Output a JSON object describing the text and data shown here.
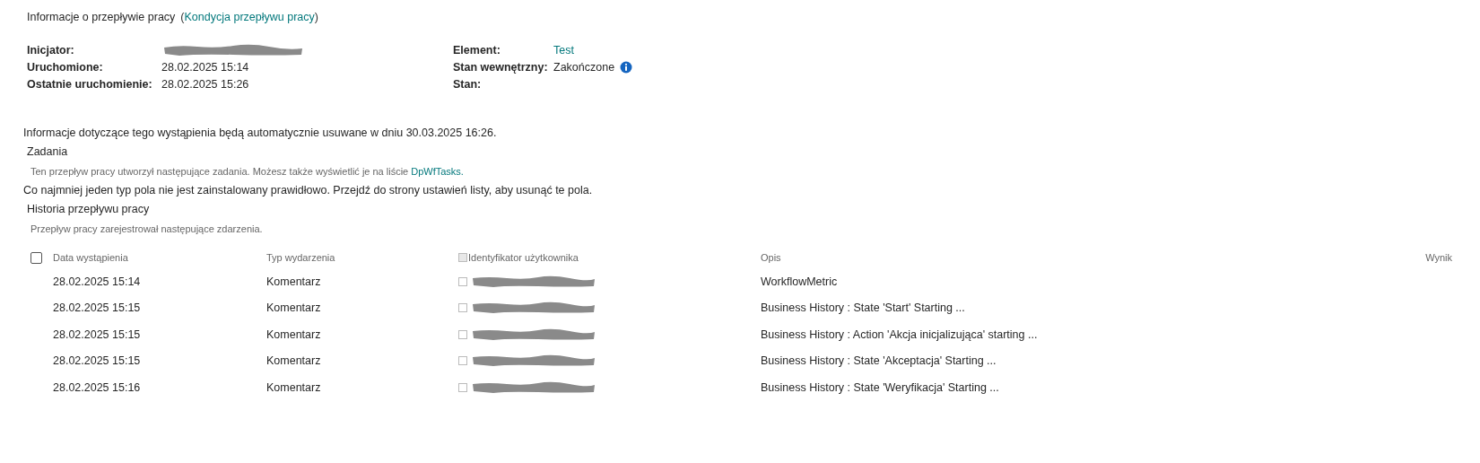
{
  "header": {
    "title": "Informacje o przepływie pracy",
    "link_open": "(",
    "link": "Kondycja przepływu pracy",
    "link_close": ")"
  },
  "info_left": [
    {
      "label": "Inicjator:",
      "redacted": true
    },
    {
      "label": "Uruchomione:",
      "value": "28.02.2025 15:14",
      "redacted": false
    },
    {
      "label": "Ostatnie uruchomienie:",
      "value": "28.02.2025 15:26",
      "redacted": false
    }
  ],
  "info_right": [
    {
      "label": "Element:",
      "value": "Test",
      "kind": "link"
    },
    {
      "label": "Stan wewnętrzny:",
      "value": "Zakończone",
      "kind": "info"
    },
    {
      "label": "Stan:",
      "kind": "empty"
    }
  ],
  "retention_notice": "Informacje dotyczące tego wystąpienia będą automatycznie usuwane w dniu 30.03.2025 16:26.",
  "tasks": {
    "title": "Zadania",
    "description": "Ten przepływ pracy utworzył następujące zadania. Możesz także wyświetlić je na liście",
    "link": "DpWfTasks."
  },
  "warning": "Co najmniej jeden typ pola nie jest zainstalowany prawidłowo. Przejdź do strony ustawień listy, aby usunąć te pola.",
  "history": {
    "title": "Historia przepływu pracy",
    "description": "Przepływ pracy zarejestrował następujące zdarzenia.",
    "select_all": {
      "checked": false
    },
    "columns": [
      "Data wystąpienia",
      "Typ wydarzenia",
      "Identyfikator użytkownika",
      "Opis",
      "Wynik"
    ],
    "rows": [
      {
        "date": "28.02.2025 15:14",
        "type": "Komentarz",
        "user_redacted": true,
        "description": "WorkflowMetric"
      },
      {
        "date": "28.02.2025 15:15",
        "type": "Komentarz",
        "user_redacted": true,
        "description": "Business History : State  'Start' Starting ..."
      },
      {
        "date": "28.02.2025 15:15",
        "type": "Komentarz",
        "user_redacted": true,
        "description": "Business History : Action 'Akcja inicjalizująca' starting ..."
      },
      {
        "date": "28.02.2025 15:15",
        "type": "Komentarz",
        "user_redacted": true,
        "description": "Business History : State  'Akceptacja' Starting ..."
      },
      {
        "date": "28.02.2025 15:16",
        "type": "Komentarz",
        "user_redacted": true,
        "description": "Business History : State  'Weryfikacja' Starting ..."
      }
    ]
  }
}
